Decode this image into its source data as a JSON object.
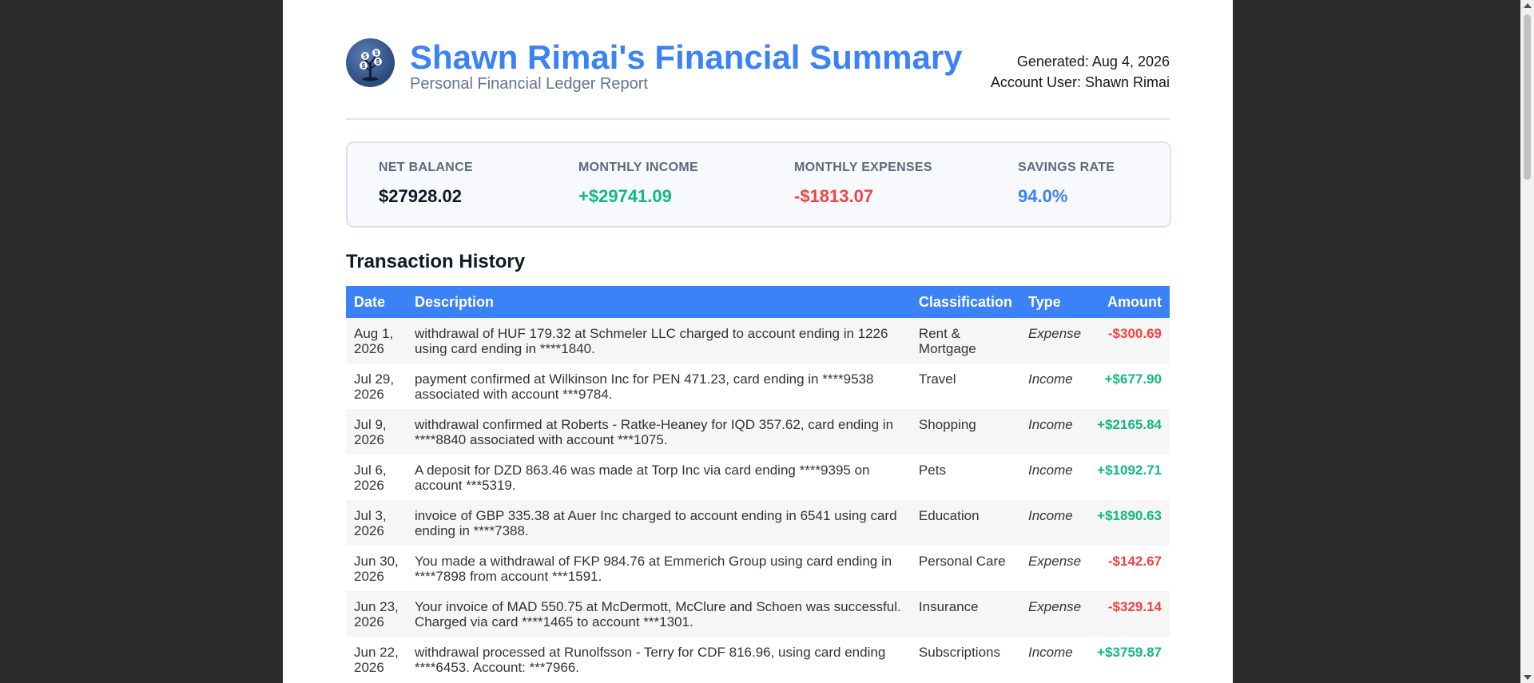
{
  "report": {
    "title": "Shawn Rimai's Financial Summary",
    "subtitle": "Personal Financial Ledger Report",
    "generated": "Generated: Aug 4, 2026",
    "account_user": "Account User: Shawn Rimai",
    "logo_icon": "money-tree-icon"
  },
  "stats": {
    "net_balance": {
      "label": "Net Balance",
      "value": "$27928.02"
    },
    "monthly_income": {
      "label": "Monthly Income",
      "value": "+$29741.09"
    },
    "monthly_expenses": {
      "label": "Monthly Expenses",
      "value": "-$1813.07"
    },
    "savings_rate": {
      "label": "Savings Rate",
      "value": "94.0%"
    }
  },
  "colors": {
    "accent": "#3b82f6",
    "income": "#10b981",
    "expense": "#ef4444"
  },
  "transactions": {
    "title": "Transaction History",
    "columns": [
      "Date",
      "Description",
      "Classification",
      "Type",
      "Amount"
    ],
    "rows": [
      {
        "date": "Aug 1, 2026",
        "description": "withdrawal of HUF 179.32 at Schmeler LLC charged to account ending in 1226 using card ending in ****1840.",
        "classification": "Rent & Mortgage",
        "type": "Expense",
        "amount": "-$300.69"
      },
      {
        "date": "Jul 29, 2026",
        "description": "payment confirmed at Wilkinson Inc for PEN 471.23, card ending in ****9538 associated with account ***9784.",
        "classification": "Travel",
        "type": "Income",
        "amount": "+$677.90"
      },
      {
        "date": "Jul 9, 2026",
        "description": "withdrawal confirmed at Roberts - Ratke-Heaney for IQD 357.62, card ending in ****8840 associated with account ***1075.",
        "classification": "Shopping",
        "type": "Income",
        "amount": "+$2165.84"
      },
      {
        "date": "Jul 6, 2026",
        "description": "A deposit for DZD 863.46 was made at Torp Inc via card ending ****9395 on account ***5319.",
        "classification": "Pets",
        "type": "Income",
        "amount": "+$1092.71"
      },
      {
        "date": "Jul 3, 2026",
        "description": "invoice of GBP 335.38 at Auer Inc charged to account ending in 6541 using card ending in ****7388.",
        "classification": "Education",
        "type": "Income",
        "amount": "+$1890.63"
      },
      {
        "date": "Jun 30, 2026",
        "description": "You made a withdrawal of FKP 984.76 at Emmerich Group using card ending in ****7898 from account ***1591.",
        "classification": "Personal Care",
        "type": "Expense",
        "amount": "-$142.67"
      },
      {
        "date": "Jun 23, 2026",
        "description": "Your invoice of MAD 550.75 at McDermott, McClure and Schoen was successful. Charged via card ****1465 to account ***1301.",
        "classification": "Insurance",
        "type": "Expense",
        "amount": "-$329.14"
      },
      {
        "date": "Jun 22, 2026",
        "description": "withdrawal processed at Runolfsson - Terry for CDF 816.96, using card ending ****6453. Account: ***7966.",
        "classification": "Subscriptions",
        "type": "Income",
        "amount": "+$3759.87"
      }
    ]
  }
}
